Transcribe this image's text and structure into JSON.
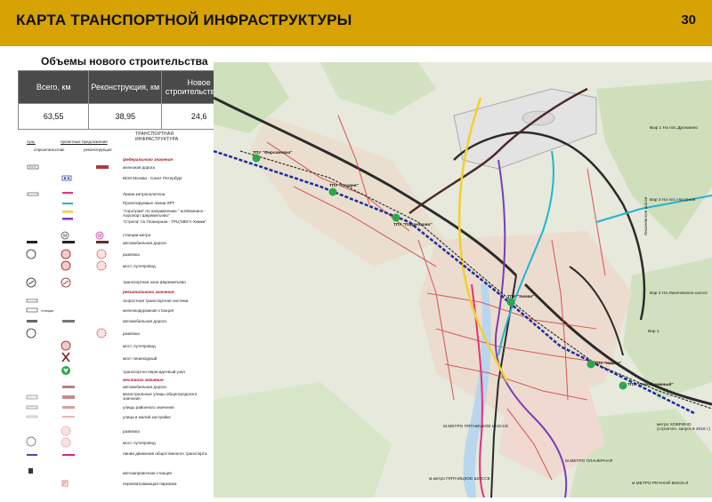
{
  "header": {
    "title": "КАРТА ТРАНСПОРТНОЙ ИНФРАСТРУКТУРЫ",
    "page_number": "30"
  },
  "volumes": {
    "title": "Объемы нового строительства",
    "columns": [
      "Всего, км",
      "Реконструкция, км",
      "Новое строительство, км"
    ],
    "values": [
      "63,55",
      "38,95",
      "24,6"
    ]
  },
  "legend": {
    "heading": "ТРАНСПОРТНАЯ ИНФРАСТРУКТУРА",
    "col_existing": "сущ.",
    "col_proposals": "проектные предложения",
    "col_construction": "строительство",
    "col_reconstruction": "реконструкция",
    "items": [
      "федерального значения",
      "железная дорога",
      "ВСМ Москва - Санкт Петербург",
      "Линии метрополитена",
      "Проектируемые линии ЛРТ",
      "\"Аэротрам\" по направлению \" м.Мякинино - Аэропорт Шереметьево\"",
      "\"Стрела\" по Планерная - ТРЦ\"МЕГА-Химки\"",
      "станции метро",
      "автомобильная дорога",
      "развязка",
      "мост, путепровод",
      "транспортная зона Шереметьево",
      "регионального значения",
      "скоростная транспортная система",
      "железнодорожная станция",
      "автомобильная дорога",
      "развязка",
      "мост, путепровод",
      "мост пешеходный",
      "транспортно-пересадочный узел",
      "местного значения",
      "автомобильная дорога",
      "магистральные улицы общегородского значения",
      "улицы районного значения",
      "улица в жилой застройке",
      "развязка",
      "мост, путепровод",
      "линии движения общественного транспорта",
      "автозаправочная станция",
      "перехватывающая парковка"
    ],
    "station_tag": "станция"
  },
  "map": {
    "labels": [
      "ТПУ \"Фирсановка\"",
      "ТПУ \"Сходня\"",
      "ТПУ \"Подрезково\"",
      "ТПУ \"Химки\"",
      "ТПУ \"Химки\"",
      "ТПУ \"Левобережный\"",
      "Выр 1 На пос.Дрожжино",
      "Вар 3 На пос.Нагорная",
      "Вар 2 На Лихачевское шоссе",
      "Вар 1",
      "Лихачевское шоссе",
      "М.МЕТРО ПЯТНИЦКОЕ ШОССЕ",
      "М.МЕТРО ПЛАНЕРНАЯ",
      "метро ХОВРИНО (строител. запуск в 2016 г.)",
      "м.метро ПЯТНИЦКОЕ ШОССЕ",
      "м.МЕТРО РЕЧНОЙ ВОКЗАЛ"
    ]
  }
}
